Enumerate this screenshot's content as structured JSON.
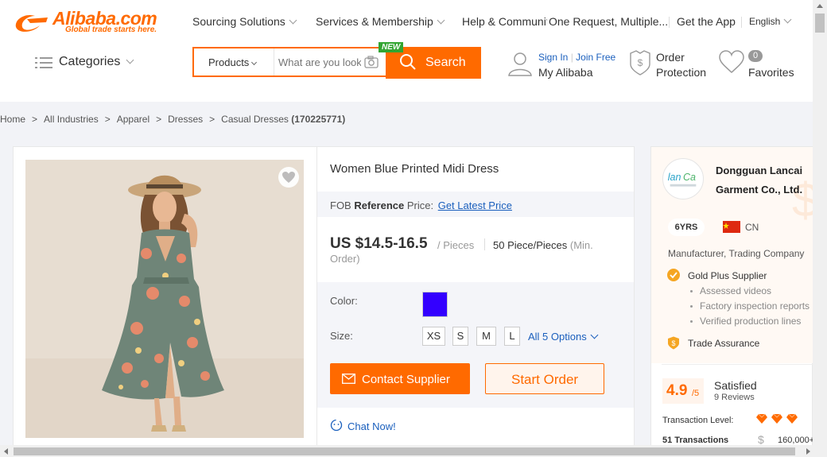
{
  "header": {
    "logo_text": "Alibaba.com",
    "logo_tagline": "Global trade starts here.",
    "nav": [
      "Sourcing Solutions",
      "Services & Membership",
      "Help & Community",
      "One Request, Multiple...",
      "Get the App",
      "English"
    ],
    "categories_label": "Categories",
    "search": {
      "scope": "Products",
      "placeholder": "What are you looking for",
      "button": "Search",
      "new_badge": "NEW"
    },
    "account": {
      "sign_in": "Sign In",
      "join_free": "Join Free",
      "my_alibaba": "My Alibaba"
    },
    "order_protection": [
      "Order",
      "Protection"
    ],
    "favorites": {
      "count": "0",
      "label": "Favorites"
    }
  },
  "breadcrumb": {
    "items": [
      "Home",
      "All Industries",
      "Apparel",
      "Dresses",
      "Casual Dresses"
    ],
    "count": "(170225771)"
  },
  "product": {
    "title": "Women Blue Printed Midi Dress",
    "fob_prefix": "FOB",
    "fob_bold": "Reference",
    "fob_suffix": "Price:",
    "fob_link": "Get Latest Price",
    "price": "US $14.5-16.5",
    "price_unit": "/ Pieces",
    "moq": "50 Piece/Pieces",
    "moq_note_a": "(Min.",
    "moq_note_b": "Order)",
    "color_label": "Color:",
    "color_swatch": "#3300ff",
    "size_label": "Size:",
    "sizes": [
      "XS",
      "S",
      "M",
      "L"
    ],
    "all_options": "All 5 Options",
    "contact_button": "Contact Supplier",
    "start_order_button": "Start Order",
    "chat": "Chat Now!"
  },
  "supplier": {
    "name": "Dongguan Lancai Garment Co., Ltd.",
    "years": "6YRS",
    "country": "CN",
    "business_type": "Manufacturer, Trading Company",
    "gold_plus": "Gold Plus Supplier",
    "verifications": [
      "Assessed videos",
      "Factory inspection reports",
      "Verified production lines"
    ],
    "trade_assurance": "Trade Assurance",
    "rating": "4.9",
    "rating_of": "/5",
    "rating_label": "Satisfied",
    "reviews": "9 Reviews",
    "transaction_level_label": "Transaction Level:",
    "transactions": "51 Transactions",
    "transaction_amount": "160,000+"
  },
  "colors": {
    "accent": "#ff6a00",
    "link": "#1a5fbd",
    "new_badge": "#33a532"
  }
}
